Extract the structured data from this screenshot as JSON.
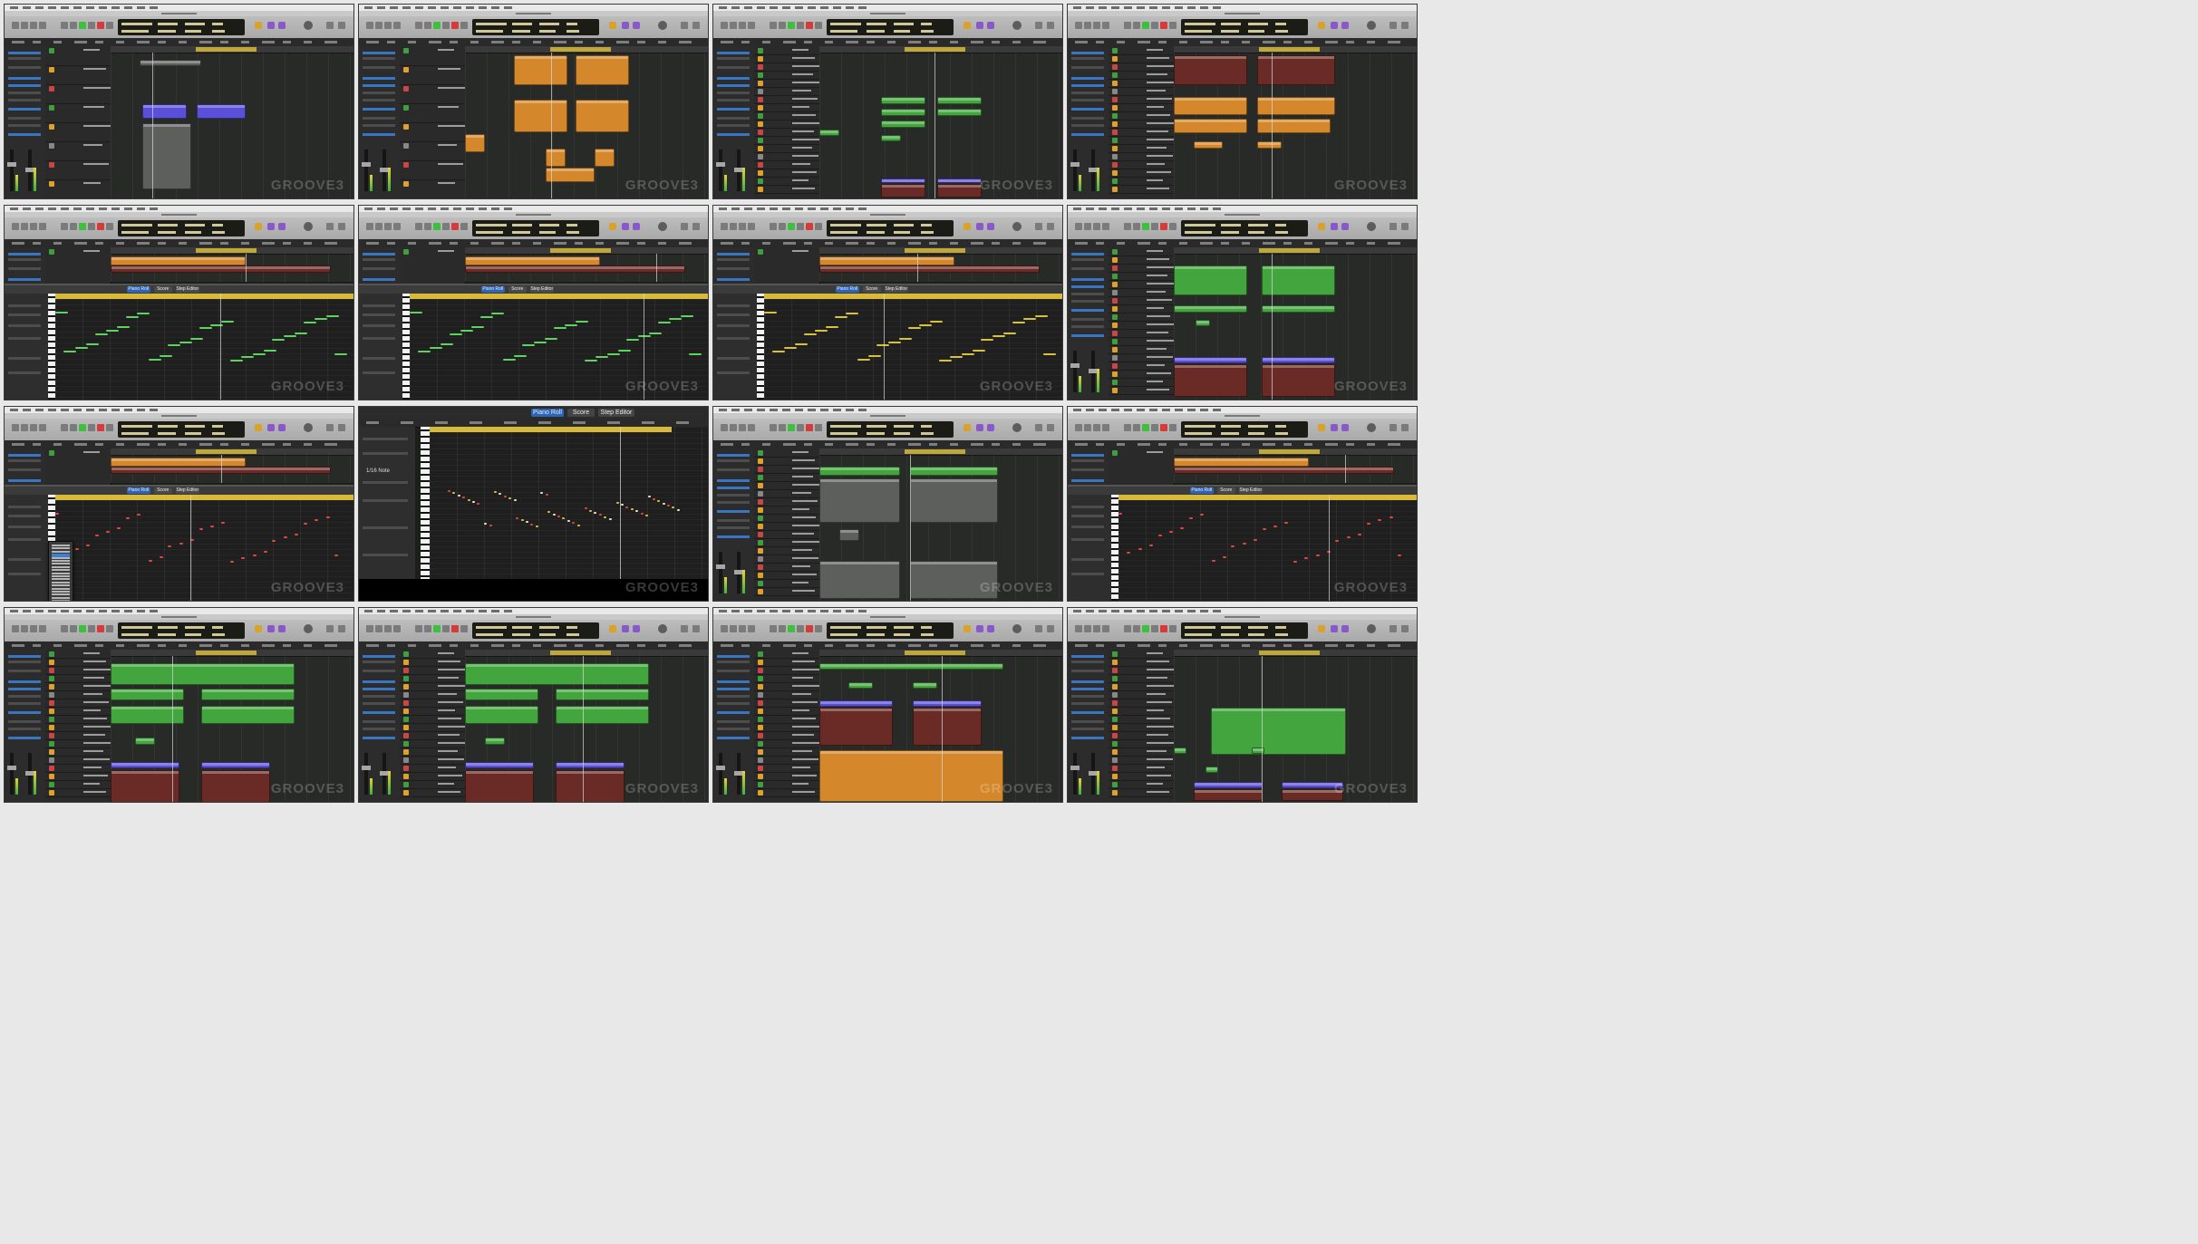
{
  "app": {
    "name": "Logic Pro",
    "watermark": "GROOVE3",
    "tabs": {
      "piano_roll": "Piano Roll",
      "score": "Score",
      "step_editor": "Step Editor"
    },
    "note_menu_value": "1/16 Note",
    "colors": {
      "green": "#43a53d",
      "orange": "#d4872b",
      "dark_red": "#6a2a25",
      "blue": "#5a4fd8",
      "gray": "#5d5f5d",
      "accent_blue": "#2d64b7"
    }
  },
  "frames": [
    {
      "kind": "arrange",
      "track_count": 8,
      "playhead": 0.17,
      "regions": [
        [
          "gray",
          0.12,
          0.05,
          0.25,
          0.04
        ],
        [
          "blue",
          0.13,
          0.35,
          0.18,
          0.1
        ],
        [
          "blue",
          0.35,
          0.35,
          0.2,
          0.1
        ],
        [
          "gray",
          0.13,
          0.48,
          0.2,
          0.45
        ]
      ]
    },
    {
      "kind": "arrange",
      "track_count": 8,
      "playhead": 0.35,
      "regions": [
        [
          "orange",
          0.2,
          0.02,
          0.22,
          0.2
        ],
        [
          "orange",
          0.45,
          0.02,
          0.22,
          0.2
        ],
        [
          "orange",
          0.2,
          0.32,
          0.22,
          0.22
        ],
        [
          "orange",
          0.45,
          0.32,
          0.22,
          0.22
        ],
        [
          "orange",
          0.0,
          0.55,
          0.08,
          0.12
        ],
        [
          "orange",
          0.33,
          0.65,
          0.08,
          0.12
        ],
        [
          "orange",
          0.53,
          0.65,
          0.08,
          0.12
        ],
        [
          "orange",
          0.33,
          0.78,
          0.2,
          0.1
        ]
      ]
    },
    {
      "kind": "arrange",
      "track_count": 18,
      "playhead": 0.47,
      "regions": [
        [
          "green",
          0.25,
          0.3,
          0.18,
          0.05
        ],
        [
          "green",
          0.25,
          0.38,
          0.18,
          0.05
        ],
        [
          "green",
          0.25,
          0.46,
          0.18,
          0.05
        ],
        [
          "green",
          0.48,
          0.3,
          0.18,
          0.05
        ],
        [
          "green",
          0.48,
          0.38,
          0.18,
          0.05
        ],
        [
          "green",
          0.0,
          0.52,
          0.08,
          0.04
        ],
        [
          "green",
          0.25,
          0.56,
          0.08,
          0.04
        ],
        [
          "blue",
          0.25,
          0.85,
          0.18,
          0.03
        ],
        [
          "blue",
          0.48,
          0.85,
          0.18,
          0.03
        ],
        [
          "red",
          0.25,
          0.89,
          0.18,
          0.09
        ],
        [
          "red",
          0.48,
          0.89,
          0.18,
          0.09
        ]
      ]
    },
    {
      "kind": "arrange",
      "track_count": 18,
      "playhead": 0.4,
      "regions": [
        [
          "red",
          0.0,
          0.02,
          0.3,
          0.2
        ],
        [
          "red",
          0.34,
          0.02,
          0.32,
          0.2
        ],
        [
          "orange",
          0.0,
          0.3,
          0.3,
          0.12
        ],
        [
          "orange",
          0.34,
          0.3,
          0.32,
          0.12
        ],
        [
          "orange",
          0.0,
          0.45,
          0.3,
          0.1
        ],
        [
          "orange",
          0.34,
          0.45,
          0.3,
          0.1
        ],
        [
          "orange",
          0.08,
          0.6,
          0.12,
          0.05
        ],
        [
          "orange",
          0.34,
          0.6,
          0.1,
          0.05
        ]
      ]
    },
    {
      "kind": "pianoroll",
      "playhead": 0.55,
      "notes": "green"
    },
    {
      "kind": "pianoroll",
      "playhead": 0.78,
      "notes": "green"
    },
    {
      "kind": "pianoroll",
      "playhead": 0.4,
      "notes": "yellow"
    },
    {
      "kind": "arrange",
      "track_count": 18,
      "playhead": 0.4,
      "regions": [
        [
          "green",
          0.0,
          0.08,
          0.3,
          0.2
        ],
        [
          "green",
          0.36,
          0.08,
          0.3,
          0.2
        ],
        [
          "green",
          0.0,
          0.35,
          0.3,
          0.05
        ],
        [
          "green",
          0.36,
          0.35,
          0.3,
          0.05
        ],
        [
          "green",
          0.09,
          0.45,
          0.06,
          0.04
        ],
        [
          "blue",
          0.0,
          0.7,
          0.3,
          0.04
        ],
        [
          "blue",
          0.36,
          0.7,
          0.3,
          0.04
        ],
        [
          "red",
          0.0,
          0.75,
          0.3,
          0.22
        ],
        [
          "red",
          0.36,
          0.75,
          0.3,
          0.22
        ]
      ]
    },
    {
      "kind": "pianoroll_menu",
      "playhead": 0.45,
      "notes": "red"
    },
    {
      "kind": "pianoroll_full",
      "playhead": 0.68,
      "notes": "red"
    },
    {
      "kind": "arrange",
      "track_count": 18,
      "playhead": 0.37,
      "regions": [
        [
          "green",
          0.0,
          0.08,
          0.33,
          0.06
        ],
        [
          "green",
          0.37,
          0.08,
          0.36,
          0.06
        ],
        [
          "gray",
          0.0,
          0.16,
          0.33,
          0.3
        ],
        [
          "gray",
          0.37,
          0.16,
          0.36,
          0.3
        ],
        [
          "gray",
          0.08,
          0.5,
          0.08,
          0.08
        ],
        [
          "gray",
          0.0,
          0.72,
          0.33,
          0.26
        ],
        [
          "gray",
          0.37,
          0.72,
          0.36,
          0.26
        ]
      ]
    },
    {
      "kind": "pianoroll",
      "playhead": 0.7,
      "notes": "red"
    },
    {
      "kind": "arrange",
      "track_count": 18,
      "playhead": 0.25,
      "regions": [
        [
          "green",
          0.0,
          0.05,
          0.75,
          0.15
        ],
        [
          "green",
          0.0,
          0.22,
          0.3,
          0.08
        ],
        [
          "green",
          0.37,
          0.22,
          0.38,
          0.08
        ],
        [
          "green",
          0.0,
          0.34,
          0.3,
          0.12
        ],
        [
          "green",
          0.37,
          0.34,
          0.38,
          0.12
        ],
        [
          "green",
          0.1,
          0.55,
          0.08,
          0.05
        ],
        [
          "blue",
          0.0,
          0.72,
          0.28,
          0.04
        ],
        [
          "blue",
          0.37,
          0.72,
          0.28,
          0.04
        ],
        [
          "red",
          0.0,
          0.77,
          0.28,
          0.22
        ],
        [
          "red",
          0.37,
          0.77,
          0.28,
          0.22
        ]
      ]
    },
    {
      "kind": "arrange",
      "track_count": 18,
      "playhead": 0.48,
      "regions": [
        [
          "green",
          0.0,
          0.05,
          0.75,
          0.15
        ],
        [
          "green",
          0.0,
          0.22,
          0.3,
          0.08
        ],
        [
          "green",
          0.37,
          0.22,
          0.38,
          0.08
        ],
        [
          "green",
          0.0,
          0.34,
          0.3,
          0.12
        ],
        [
          "green",
          0.37,
          0.34,
          0.38,
          0.12
        ],
        [
          "green",
          0.08,
          0.55,
          0.08,
          0.05
        ],
        [
          "blue",
          0.0,
          0.72,
          0.28,
          0.04
        ],
        [
          "blue",
          0.37,
          0.72,
          0.28,
          0.04
        ],
        [
          "red",
          0.0,
          0.77,
          0.28,
          0.22
        ],
        [
          "red",
          0.37,
          0.77,
          0.28,
          0.22
        ]
      ]
    },
    {
      "kind": "arrange",
      "track_count": 18,
      "playhead": 0.5,
      "regions": [
        [
          "green",
          0.0,
          0.05,
          0.75,
          0.04
        ],
        [
          "green",
          0.12,
          0.18,
          0.1,
          0.04
        ],
        [
          "green",
          0.38,
          0.18,
          0.1,
          0.04
        ],
        [
          "blue",
          0.0,
          0.3,
          0.3,
          0.04
        ],
        [
          "blue",
          0.38,
          0.3,
          0.28,
          0.04
        ],
        [
          "red",
          0.0,
          0.35,
          0.3,
          0.26
        ],
        [
          "red",
          0.38,
          0.35,
          0.28,
          0.26
        ],
        [
          "orange",
          0.0,
          0.64,
          0.75,
          0.35
        ]
      ]
    },
    {
      "kind": "arrange",
      "track_count": 18,
      "playhead": 0.36,
      "regions": [
        [
          "green",
          0.15,
          0.35,
          0.55,
          0.32
        ],
        [
          "green",
          0.0,
          0.62,
          0.05,
          0.04
        ],
        [
          "green",
          0.32,
          0.62,
          0.05,
          0.04
        ],
        [
          "green",
          0.13,
          0.75,
          0.05,
          0.04
        ],
        [
          "blue",
          0.08,
          0.85,
          0.28,
          0.04
        ],
        [
          "blue",
          0.44,
          0.85,
          0.25,
          0.04
        ],
        [
          "red",
          0.08,
          0.9,
          0.28,
          0.08
        ],
        [
          "red",
          0.44,
          0.9,
          0.25,
          0.08
        ]
      ]
    }
  ]
}
